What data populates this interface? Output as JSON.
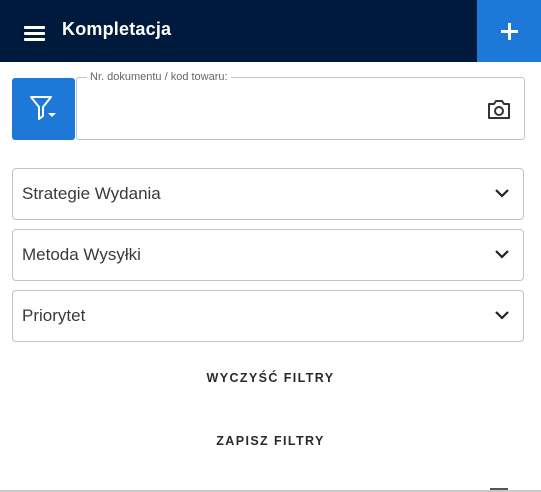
{
  "header": {
    "title": "Kompletacja",
    "menu_icon": "hamburger-menu-icon",
    "add_icon": "plus-icon",
    "background_color": "#001a3d",
    "accent_color": "#1e78d7"
  },
  "search": {
    "label": "Nr. dokumentu / kod towaru:",
    "value": "",
    "filter_icon": "filter-dropdown-icon",
    "camera_icon": "camera-icon"
  },
  "filters": [
    {
      "label": "Strategie Wydania"
    },
    {
      "label": "Metoda Wysyłki"
    },
    {
      "label": "Priorytet"
    }
  ],
  "actions": {
    "clear_label": "WYCZYŚĆ FILTRY",
    "save_label": "ZAPISZ FILTRY"
  }
}
